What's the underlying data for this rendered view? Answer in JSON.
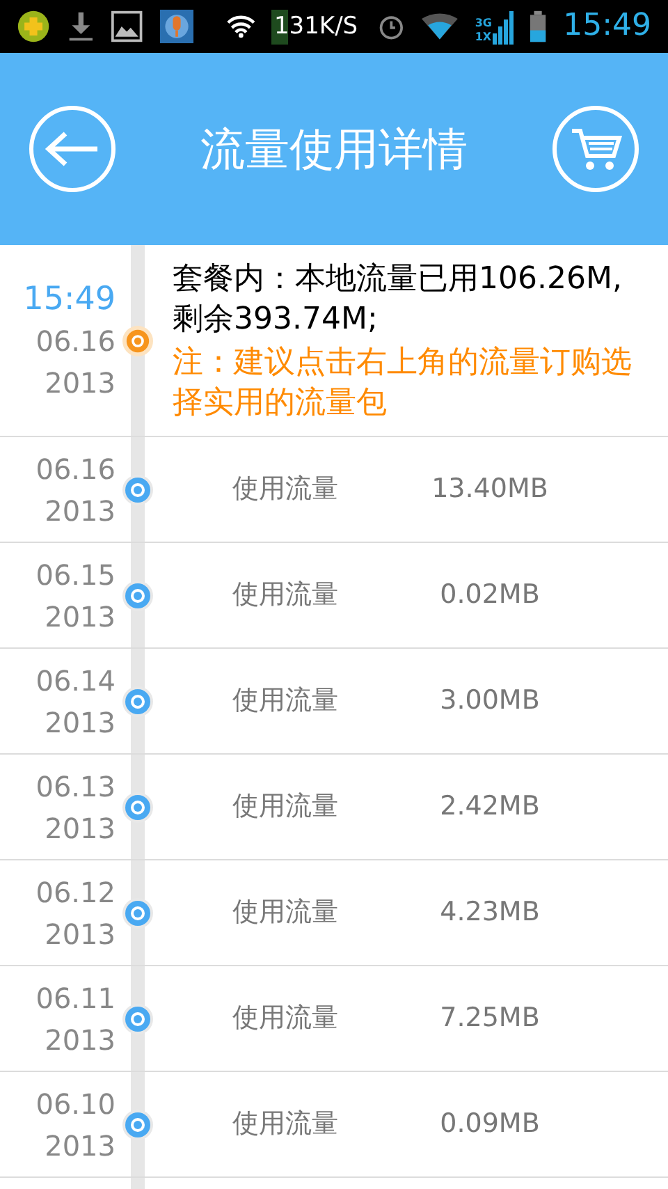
{
  "status_bar": {
    "speed": "131K/S",
    "network_top": "3G",
    "network_bottom": "1X",
    "time": "15:49"
  },
  "header": {
    "title": "流量使用详情"
  },
  "summary": {
    "time": "15:49",
    "date": "06.16",
    "year": "2013",
    "text": "套餐内：本地流量已用106.26M,剩余393.74M;",
    "note": "注：建议点击右上角的流量订购选择实用的流量包"
  },
  "records": [
    {
      "date": "06.16",
      "year": "2013",
      "label": "使用流量",
      "value": "13.40MB"
    },
    {
      "date": "06.15",
      "year": "2013",
      "label": "使用流量",
      "value": "0.02MB"
    },
    {
      "date": "06.14",
      "year": "2013",
      "label": "使用流量",
      "value": "3.00MB"
    },
    {
      "date": "06.13",
      "year": "2013",
      "label": "使用流量",
      "value": "2.42MB"
    },
    {
      "date": "06.12",
      "year": "2013",
      "label": "使用流量",
      "value": "4.23MB"
    },
    {
      "date": "06.11",
      "year": "2013",
      "label": "使用流量",
      "value": "7.25MB"
    },
    {
      "date": "06.10",
      "year": "2013",
      "label": "使用流量",
      "value": "0.09MB"
    }
  ]
}
